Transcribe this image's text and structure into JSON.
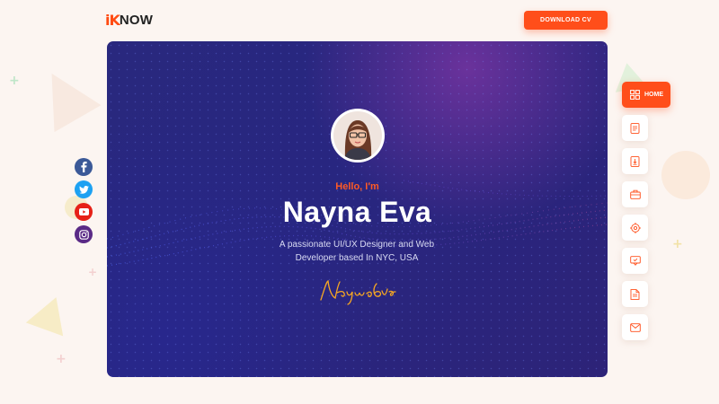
{
  "brand": {
    "logo_mark": "iK",
    "logo_word": "NOW"
  },
  "header": {
    "cta_label": "DOWNLOAD CV"
  },
  "hero": {
    "greeting": "Hello, I'm",
    "name": "Nayna Eva",
    "tagline_line1": "A passionate UI/UX Designer and Web",
    "tagline_line2": "Developer based In NYC, USA",
    "signature": "Nayna Eva"
  },
  "social": [
    {
      "icon": "facebook-icon",
      "color": "#3b5998"
    },
    {
      "icon": "twitter-icon",
      "color": "#1da1f2"
    },
    {
      "icon": "youtube-icon",
      "color": "#e62117"
    },
    {
      "icon": "instagram-icon",
      "color": "#5a2a86"
    }
  ],
  "nav": {
    "active_label": "HOME",
    "items": [
      "home-grid-icon",
      "resume-icon",
      "download-doc-icon",
      "briefcase-icon",
      "target-icon",
      "chat-icon",
      "document-icon",
      "mail-icon"
    ]
  },
  "colors": {
    "accent": "#ff4e1a",
    "hero_bg": "#29287e",
    "page_bg": "#fcf5f1"
  }
}
